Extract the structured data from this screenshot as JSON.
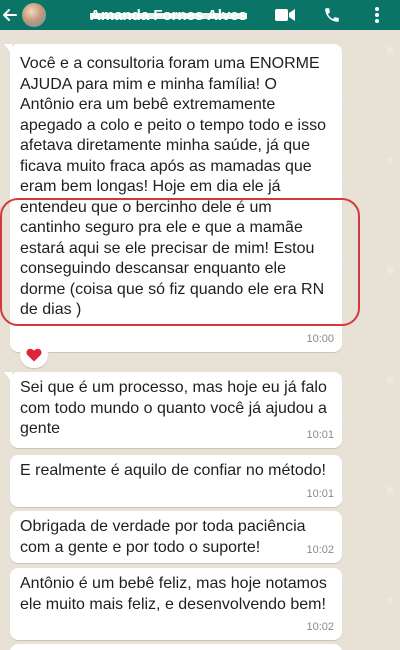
{
  "header": {
    "contact_name": "Amanda Fornes Alves",
    "back_icon": "arrow-left-icon",
    "avatar_icon": "contact-avatar",
    "video_icon": "video-call-icon",
    "call_icon": "phone-icon",
    "menu_icon": "kebab-menu-icon",
    "color": "#0a7466"
  },
  "messages": [
    {
      "text": "Você e a consultoria foram uma ENORME AJUDA para mim e minha família! O Antônio era um bebê extremamente apegado a colo e peito o tempo todo e isso afetava diretamente minha saúde, já que ficava muito fraca após as mamadas que eram bem longas! Hoje em dia ele já entendeu que o bercinho dele é um cantinho seguro pra ele e que a mamãe estará aqui se ele precisar de mim!  Estou conseguindo descansar enquanto ele dorme (coisa que só fiz quando ele era RN de dias )",
      "time": "10:00",
      "reaction": "heart"
    },
    {
      "text": "Sei que é um processo, mas hoje eu já falo com todo mundo o quanto você já ajudou a gente",
      "time": "10:01"
    },
    {
      "text": "E realmente é aquilo de confiar no método!",
      "time": "10:01"
    },
    {
      "text": "Obrigada de verdade por toda paciência com a gente e por todo o suporte!",
      "time": "10:02"
    },
    {
      "text": "Antônio é um bebê feliz, mas hoje notamos ele muito mais feliz, e desenvolvendo bem!",
      "time": "10:02"
    }
  ],
  "colors": {
    "bubble": "#ffffff",
    "highlight": "#d23a3a",
    "time": "#8a8a8a"
  }
}
